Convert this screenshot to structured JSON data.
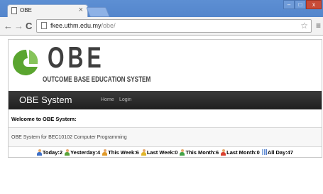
{
  "browser": {
    "tab_title": "OBE",
    "tab_close": "×",
    "url_host": "fkee.uthm.edu.my",
    "url_path": "/obe/",
    "window_buttons": [
      "–",
      "□",
      "x"
    ]
  },
  "header": {
    "logo_text": "OBE",
    "logo_subtitle": "OUTCOME BASE EDUCATION SYSTEM"
  },
  "navbar": {
    "brand": "OBE System",
    "links": [
      "Home",
      "Login"
    ]
  },
  "main": {
    "welcome": "Welcome to OBE System:",
    "description": "OBE System for BEC10102 Computer Programming"
  },
  "counter": [
    {
      "label": "Today:2",
      "icon": "person-icon",
      "color": "#3d6fc6"
    },
    {
      "label": "Yesterday:4",
      "icon": "person-icon",
      "color": "#5aa33a"
    },
    {
      "label": "This Week:6",
      "icon": "person-icon",
      "color": "#e09a2a"
    },
    {
      "label": "Last Week:0",
      "icon": "person-icon",
      "color": "#e0b52a"
    },
    {
      "label": "This Month:6",
      "icon": "person-icon",
      "color": "#43a247"
    },
    {
      "label": "Last Month:0",
      "icon": "person-icon",
      "color": "#d9412f"
    },
    {
      "label": "All Day:47",
      "icon": "chart-icon",
      "color": "#4d79c8"
    }
  ],
  "colors": {
    "logo_green": "#5aa52f",
    "navbar": "#2a2a2a",
    "chrome_blue": "#5d8fd3"
  }
}
